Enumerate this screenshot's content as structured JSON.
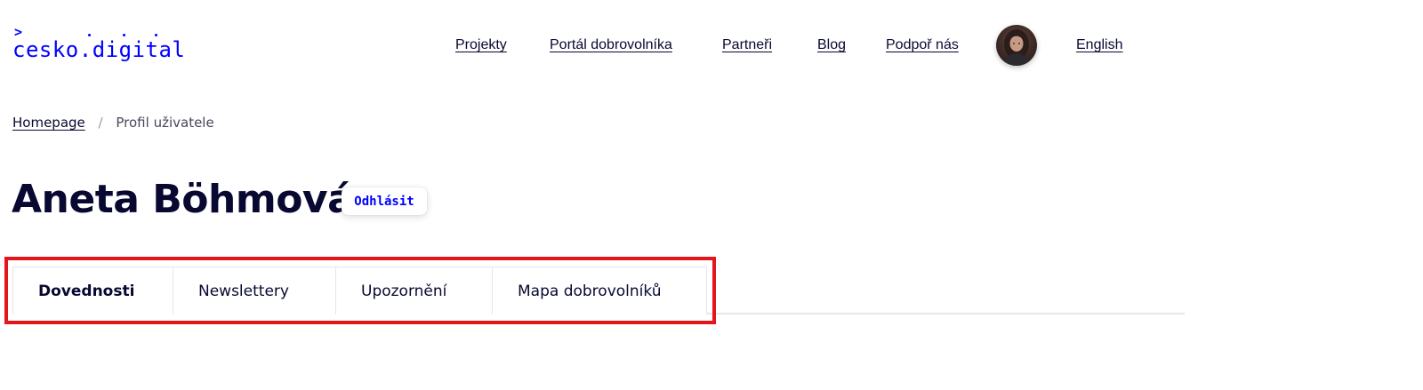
{
  "header": {
    "logo": {
      "prompt": ">",
      "text": "cesko.digital"
    },
    "nav": {
      "items": [
        {
          "label": "Projekty"
        },
        {
          "label": "Portál dobrovolníka"
        },
        {
          "label": "Partneři"
        },
        {
          "label": "Blog"
        },
        {
          "label": "Podpoř nás"
        }
      ],
      "language_label": "English"
    },
    "avatar_icon": "user-avatar"
  },
  "breadcrumb": {
    "home_label": "Homepage",
    "separator": "/",
    "current_label": "Profil uživatele"
  },
  "profile": {
    "name": "Aneta Böhmová",
    "logout_label": "Odhlásit"
  },
  "tabs": {
    "items": [
      {
        "label": "Dovednosti",
        "active": true
      },
      {
        "label": "Newslettery",
        "active": false
      },
      {
        "label": "Upozornění",
        "active": false
      },
      {
        "label": "Mapa dobrovolníků",
        "active": false
      }
    ]
  },
  "colors": {
    "brand_blue": "#0000ff",
    "text_dark": "#080831",
    "highlight_red": "#e3161c",
    "divider": "#e6e6ec"
  }
}
